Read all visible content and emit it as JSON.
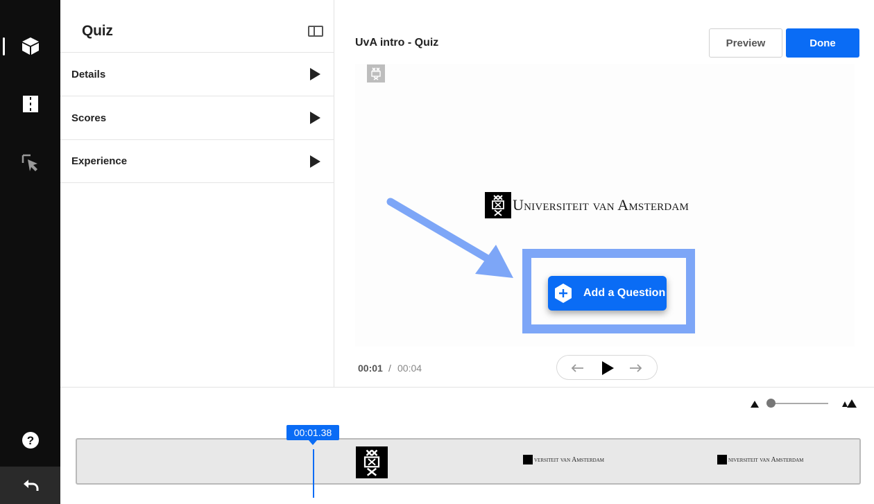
{
  "rail": {
    "items": [
      {
        "icon": "cube-icon"
      },
      {
        "icon": "film-strip-icon"
      },
      {
        "icon": "cursor-select-icon"
      }
    ],
    "help_icon": "question-circle-icon",
    "back_icon": "undo-arrow-icon"
  },
  "panel": {
    "title": "Quiz",
    "sections": [
      {
        "label": "Details"
      },
      {
        "label": "Scores"
      },
      {
        "label": "Experience"
      }
    ]
  },
  "editor": {
    "title": "UvA intro - Quiz",
    "preview_label": "Preview",
    "done_label": "Done",
    "logo_text": "Universiteit van Amsterdam",
    "add_question_label": "Add a Question",
    "time_current": "00:01",
    "time_separator": "/",
    "time_total": "00:04"
  },
  "timeline": {
    "playhead_time": "00:01.38",
    "thumb_text": "versiteit van Amsterdam",
    "thumb_text_2": "niversiteit van Amsterdam"
  },
  "colors": {
    "accent": "#0a6cf5",
    "highlight": "#7da6f7",
    "rail_bg": "#0e0e0e"
  }
}
